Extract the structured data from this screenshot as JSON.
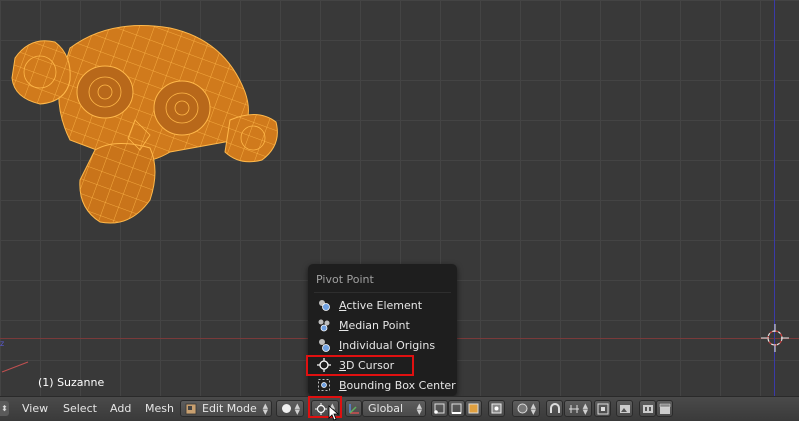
{
  "viewport": {
    "object_label": "(1) Suzanne",
    "mesh_color": "#e08a1e",
    "wire_color": "#ffb84a"
  },
  "pivot_menu": {
    "title": "Pivot Point",
    "items": [
      {
        "label": "Active Element",
        "icon": "active-element-icon"
      },
      {
        "label": "Median Point",
        "icon": "median-point-icon"
      },
      {
        "label": "Individual Origins",
        "icon": "individual-origins-icon"
      },
      {
        "label": "3D Cursor",
        "icon": "cursor-3d-icon",
        "highlighted": true
      },
      {
        "label": "Bounding Box Center",
        "icon": "bounding-box-center-icon"
      }
    ]
  },
  "header": {
    "menus": [
      "View",
      "Select",
      "Add",
      "Mesh"
    ],
    "mode": "Edit Mode",
    "orientation": "Global"
  },
  "colors": {
    "highlight": "#e01010",
    "active_button": "#5577aa"
  }
}
